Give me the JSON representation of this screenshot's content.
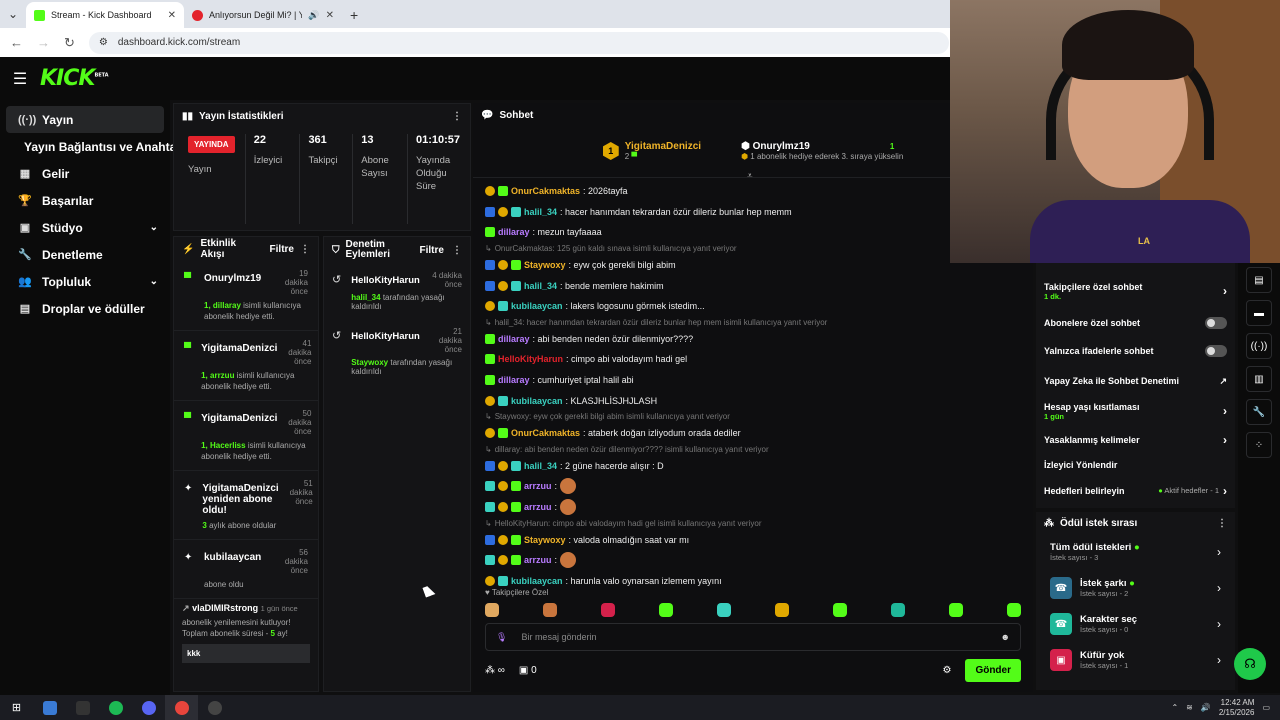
{
  "browser": {
    "tabs": [
      {
        "title": "Stream - Kick Dashboard",
        "close": "✕"
      },
      {
        "title": "Anlıyorsun Değil Mi? | YouTube",
        "close": "✕"
      }
    ],
    "new_tab": "+",
    "url": "dashboard.kick.com/stream"
  },
  "brand": {
    "logo": "KICK",
    "beta": "BETA",
    "accent": "#53fc18"
  },
  "sidebar": {
    "items": [
      {
        "label": "Yayın",
        "icon": "broadcast-icon"
      },
      {
        "label": "Yayın Bağlantısı ve Anahtarı",
        "icon": ""
      },
      {
        "label": "Gelir",
        "icon": "revenue-icon"
      },
      {
        "label": "Başarılar",
        "icon": "trophy-icon"
      },
      {
        "label": "Stüdyo",
        "icon": "studio-icon",
        "expand": true
      },
      {
        "label": "Denetleme",
        "icon": "wrench-icon"
      },
      {
        "label": "Topluluk",
        "icon": "community-icon",
        "expand": true
      },
      {
        "label": "Droplar ve ödüller",
        "icon": "drops-icon"
      }
    ]
  },
  "stats": {
    "title": "Yayın İstatistikleri",
    "live": "YAYINDA",
    "live_label": "Yayın",
    "viewers": "22",
    "viewers_label": "İzleyici",
    "followers": "361",
    "followers_label": "Takipçi",
    "subs": "13",
    "subs_label": "Abone Sayısı",
    "duration": "01:10:57",
    "duration_label": "Yayında Olduğu Süre"
  },
  "activity": {
    "title": "Etkinlik Akışı",
    "filter": "Filtre",
    "events": [
      {
        "name": "Onurylmz19",
        "time": "19 dakika önce",
        "count": "1,",
        "who": "dillaray",
        "desc": "isimli kullanıcıya abonelik hediye etti."
      },
      {
        "name": "YigitamaDenizci",
        "time": "41 dakika önce",
        "count": "1,",
        "who": "arrzuu",
        "desc": "isimli kullanıcıya abonelik hediye etti."
      },
      {
        "name": "YigitamaDenizci",
        "time": "50 dakika önce",
        "count": "1,",
        "who": "Hacerliss",
        "desc": "isimli kullanıcıya abonelik hediye etti."
      },
      {
        "name": "YigitamaDenizci yeniden abone oldu!",
        "time": "51 dakika önce",
        "count": "3",
        "who": "",
        "desc": "aylık abone oldular"
      },
      {
        "name": "kubilaaycan",
        "time": "56 dakika önce",
        "count": "",
        "who": "",
        "desc": "abone oldu"
      }
    ],
    "last": {
      "name": "vlaDIMIRstrong",
      "time": "1 gün önce",
      "desc": "abonelik yenilemesini kutluyor! Toplam abonelik süresi -",
      "months": "5",
      "suffix": "ay!",
      "msg": "kkk"
    }
  },
  "moderation": {
    "title": "Denetim Eylemleri",
    "filter": "Filtre",
    "actions": [
      {
        "name": "HelloKityHarun",
        "time": "4 dakika önce",
        "who": "halil_34",
        "desc": "tarafından yasağı kaldırıldı"
      },
      {
        "name": "HelloKityHarun",
        "time": "21 dakika önce",
        "who": "Staywoxy",
        "desc": "tarafından yasağı kaldırıldı"
      }
    ]
  },
  "chat": {
    "title": "Sohbet",
    "pinned": [
      {
        "name": "YigitamaDenizci",
        "count": "2"
      },
      {
        "name": "Onurylmz19",
        "count": "1",
        "desc": "1 abonelik hediye ederek 3. sıraya yükselin"
      }
    ],
    "messages": [
      {
        "user": "OnurCakmaktas",
        "color": "#f0b429",
        "text": ": 2026tayfa",
        "badges": [
          "gold",
          "green"
        ]
      },
      {
        "user": "halil_34",
        "color": "#3ad1c0",
        "text": ": hacer hanımdan tekrardan özür dileriz bunlar hep memm",
        "badges": [
          "blue",
          "gold",
          "teal"
        ]
      },
      {
        "user": "dillaray",
        "color": "#b87cff",
        "text": ": mezun tayfaaaa",
        "badges": [
          "green"
        ]
      },
      {
        "reply": "OnurCakmaktas: 125 gün kaldı sınava isimli kullanıcıya yanıt veriyor"
      },
      {
        "user": "Staywoxy",
        "color": "#f0b429",
        "text": ": eyw çok gerekli bilgi abim",
        "badges": [
          "blue",
          "gold",
          "green"
        ]
      },
      {
        "user": "halil_34",
        "color": "#3ad1c0",
        "text": ": bende memlere hakimim",
        "badges": [
          "blue",
          "gold",
          "teal"
        ]
      },
      {
        "user": "kubilaaycan",
        "color": "#3ad1c0",
        "text": ": lakers logosunu görmek istedim...",
        "badges": [
          "gold",
          "teal"
        ]
      },
      {
        "reply": "halil_34: hacer hanımdan tekrardan özür dileriz bunlar hep mem isimli kullanıcıya yanıt veriyor"
      },
      {
        "user": "dillaray",
        "color": "#b87cff",
        "text": ": abi benden neden özür dilenmiyor????",
        "badges": [
          "green"
        ]
      },
      {
        "user": "HelloKityHarun",
        "color": "#e3232c",
        "text": ": cimpo abi valodayım hadi gel",
        "badges": [
          "green"
        ]
      },
      {
        "user": "dillaray",
        "color": "#b87cff",
        "text": ": cumhuriyet iptal halil abi",
        "badges": [
          "green"
        ]
      },
      {
        "user": "kubilaaycan",
        "color": "#3ad1c0",
        "text": ": KLASJHLİSJHJLASH",
        "badges": [
          "gold",
          "teal"
        ]
      },
      {
        "reply": "Staywoxy: eyw çok gerekli bilgi abim isimli kullanıcıya yanıt veriyor"
      },
      {
        "user": "OnurCakmaktas",
        "color": "#f0b429",
        "text": ": ataberk doğan izliyodum orada dediler",
        "badges": [
          "gold",
          "green"
        ]
      },
      {
        "reply": "dillaray: abi benden neden özür dilenmiyor???? isimli kullanıcıya yanıt veriyor"
      },
      {
        "user": "halil_34",
        "color": "#3ad1c0",
        "text": ": 2 güne hacerde alışır : D",
        "badges": [
          "blue",
          "gold",
          "teal"
        ]
      },
      {
        "user": "arrzuu",
        "color": "#b87cff",
        "text": ":",
        "badges": [
          "teal",
          "gold",
          "green"
        ],
        "emote": true
      },
      {
        "user": "arrzuu",
        "color": "#b87cff",
        "text": ":",
        "badges": [
          "teal",
          "gold",
          "green"
        ],
        "emote": true
      },
      {
        "reply": "HelloKityHarun: cimpo abi valodayım hadi gel isimli kullanıcıya yanıt veriyor"
      },
      {
        "user": "Staywoxy",
        "color": "#f0b429",
        "text": ": valoda olmadığın saat var mı",
        "badges": [
          "blue",
          "gold",
          "green"
        ]
      },
      {
        "user": "arrzuu",
        "color": "#b87cff",
        "text": ":",
        "badges": [
          "teal",
          "gold",
          "green"
        ],
        "emote": true
      },
      {
        "user": "kubilaaycan",
        "color": "#3ad1c0",
        "text": ": harunla valo oynarsan izlemem yayını",
        "badges": [
          "gold",
          "teal"
        ]
      }
    ],
    "followers_only": "Takipçilere Özel",
    "placeholder": "Bir mesaj gönderin",
    "infinity": "∞",
    "points": "0",
    "send": "Gönder"
  },
  "chat_settings": {
    "items": [
      {
        "label": "Takipçilere özel sohbet",
        "sub": "1 dk.",
        "type": "arrow"
      },
      {
        "label": "Abonelere özel sohbet",
        "type": "toggle"
      },
      {
        "label": "Yalnızca ifadelerle sohbet",
        "type": "toggle"
      },
      {
        "label": "Yapay Zeka ile Sohbet Denetimi",
        "type": "link"
      },
      {
        "label": "Hesap yaşı kısıtlaması",
        "sub": "1 gün",
        "type": "arrow"
      },
      {
        "label": "Yasaklanmış kelimeler",
        "type": "arrow"
      },
      {
        "label": "İzleyici Yönlendir",
        "type": "none"
      },
      {
        "label": "Hedefleri belirleyin",
        "extra": "Aktif hedefler - 1",
        "type": "arrow"
      }
    ]
  },
  "rewards": {
    "title": "Ödül istek sırası",
    "items": [
      {
        "label": "Tüm ödül istekleri",
        "sub": "İstek sayısı - 3",
        "color": ""
      },
      {
        "label": "İstek şarkı",
        "sub": "İstek sayısı - 2",
        "color": "#2a6a8a"
      },
      {
        "label": "Karakter seç",
        "sub": "İstek sayısı - 0",
        "color": "#1fb89a"
      },
      {
        "label": "Küfür yok",
        "sub": "İstek sayısı - 1",
        "color": "#d4214b"
      }
    ]
  },
  "webcam": {
    "shirt_text": "LA"
  },
  "taskbar": {
    "time": "12:42 AM",
    "date": "2/15/2026"
  }
}
